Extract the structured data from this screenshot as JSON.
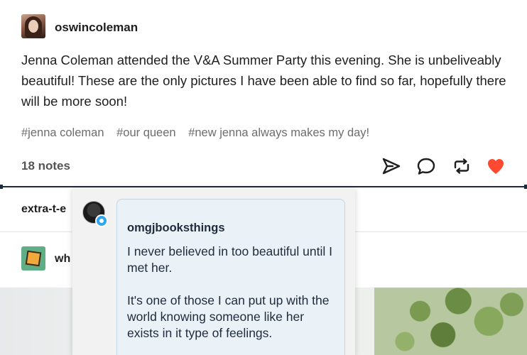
{
  "post": {
    "username": "oswincoleman",
    "body": "Jenna Coleman attended the V&A Summer Party this evening. She is unbeliveably beautiful! These are the only pictures I have been able to find so far, hopefully there will be more soon!",
    "tags": [
      "#jenna coleman",
      "#our queen",
      "#new jenna always makes my day!"
    ],
    "notes_count": "18 notes",
    "actions": {
      "share_icon": "paper-plane-icon",
      "reply_icon": "speech-bubble-icon",
      "reblog_icon": "reblog-icon",
      "like_icon": "heart-icon",
      "like_color": "#ff4930"
    }
  },
  "feed": {
    "next_user_1": "extra-t-e",
    "next_user_2": "wh"
  },
  "popover": {
    "username": "omgjbooksthings",
    "paragraphs": [
      "I never believed in too beautiful until I met her.",
      "It's one of those I can put up with the world knowing someone like her exists in it type of feelings."
    ],
    "badge_color": "#2ea7f0"
  }
}
